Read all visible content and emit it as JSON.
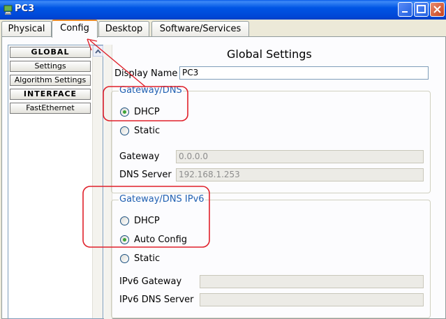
{
  "window": {
    "title": "PC3"
  },
  "tabs": [
    {
      "label": "Physical",
      "active": false
    },
    {
      "label": "Config",
      "active": true
    },
    {
      "label": "Desktop",
      "active": false
    },
    {
      "label": "Software/Services",
      "active": false
    }
  ],
  "sidebar": {
    "items": [
      {
        "label": "GLOBAL",
        "kind": "header"
      },
      {
        "label": "Settings",
        "kind": "item"
      },
      {
        "label": "Algorithm Settings",
        "kind": "item"
      },
      {
        "label": "INTERFACE",
        "kind": "header"
      },
      {
        "label": "FastEthernet",
        "kind": "item"
      }
    ]
  },
  "main": {
    "title": "Global Settings",
    "display_name_label": "Display Name",
    "display_name_value": "PC3",
    "gateway_dns": {
      "legend": "Gateway/DNS",
      "dhcp_label": "DHCP",
      "static_label": "Static",
      "selected": "DHCP",
      "gateway_label": "Gateway",
      "gateway_value": "0.0.0.0",
      "dns_label": "DNS Server",
      "dns_value": "192.168.1.253"
    },
    "gateway_dns_ipv6": {
      "legend": "Gateway/DNS IPv6",
      "dhcp_label": "DHCP",
      "auto_config_label": "Auto Config",
      "static_label": "Static",
      "selected": "Auto Config",
      "ipv6_gateway_label": "IPv6 Gateway",
      "ipv6_gateway_value": "",
      "ipv6_dns_label": "IPv6 DNS Server",
      "ipv6_dns_value": ""
    }
  },
  "colors": {
    "titlebar": "#0055e5",
    "annotation": "#e0202a",
    "legend": "#2161b2",
    "radio_check": "#3da438"
  }
}
